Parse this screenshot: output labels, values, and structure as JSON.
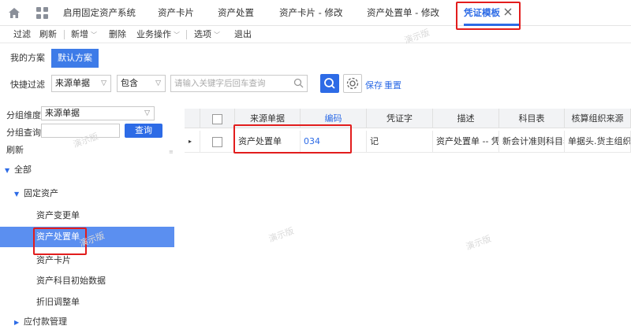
{
  "tabs": [
    {
      "label": "启用固定资产系统"
    },
    {
      "label": "资产卡片"
    },
    {
      "label": "资产处置"
    },
    {
      "label": "资产卡片 - 修改"
    },
    {
      "label": "资产处置单 - 修改"
    },
    {
      "label": "凭证模板",
      "active": true
    }
  ],
  "toolbar": {
    "filter": "过滤",
    "refresh": "刷新",
    "add": "新增",
    "delete": "删除",
    "business": "业务操作",
    "options": "选项",
    "exit": "退出"
  },
  "schemes": {
    "mine": "我的方案",
    "default": "默认方案"
  },
  "quick_filter": {
    "label": "快捷过滤",
    "field": "来源单据",
    "operator": "包含",
    "placeholder": "请输入关键字后回车查询",
    "save": "保存",
    "reset": "重置"
  },
  "left": {
    "group_dim_label": "分组维度",
    "group_dim_value": "来源单据",
    "group_query_label": "分组查询",
    "query_button": "查询",
    "refresh": "刷新",
    "tree": [
      {
        "label": "全部"
      },
      {
        "label": "固定资产"
      },
      {
        "label": "资产变更单"
      },
      {
        "label": "资产处置单",
        "selected": true
      },
      {
        "label": "资产卡片"
      },
      {
        "label": "资产科目初始数据"
      },
      {
        "label": "折旧调整单"
      },
      {
        "label": "应付款管理"
      }
    ]
  },
  "grid": {
    "columns": [
      "来源单据",
      "编码",
      "凭证字",
      "描述",
      "科目表",
      "核算组织来源"
    ],
    "rows": [
      {
        "source": "资产处置单",
        "code": "034",
        "voucher": "记",
        "desc": "资产处置单 -- 凭证",
        "account_table": "新会计准则科目表",
        "org_source": "单据头.货主组织"
      }
    ]
  },
  "watermark": "演示版",
  "colors": {
    "accent": "#2d6be6",
    "highlight": "#e21d1d",
    "selected_row": "#5b8ff0"
  }
}
